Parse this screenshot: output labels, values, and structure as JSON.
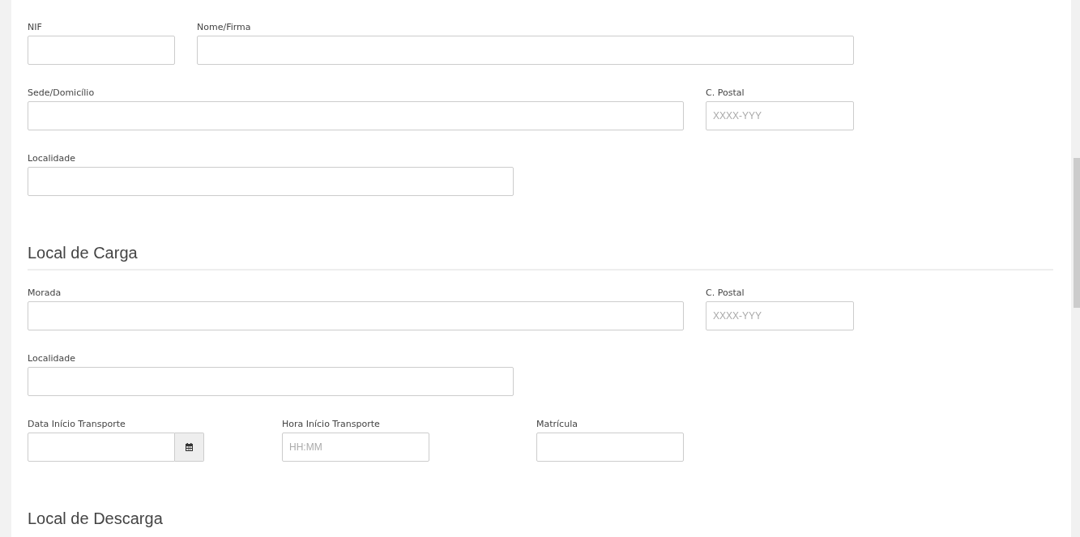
{
  "form": {
    "rows": [
      [
        {
          "label": "NIF",
          "kind": "text"
        },
        {
          "label": "Nome/Firma",
          "kind": "text"
        }
      ],
      [
        {
          "label": "Sede/Domicílio",
          "kind": "text"
        },
        {
          "label": "C. Postal",
          "kind": "text",
          "placeholder": "XXXX-YYY"
        }
      ],
      [
        {
          "label": "Localidade",
          "kind": "text"
        }
      ]
    ]
  },
  "sections": [
    {
      "heading": "Local de Carga",
      "rows": [
        [
          {
            "label": "Morada",
            "kind": "text"
          },
          {
            "label": "C. Postal",
            "kind": "text",
            "placeholder": "XXXX-YYY"
          }
        ],
        [
          {
            "label": "Localidade",
            "kind": "text"
          }
        ],
        [
          {
            "label": "Data Início Transporte",
            "kind": "date"
          },
          {
            "label": "Hora Início Transporte",
            "kind": "text",
            "placeholder": "HH:MM"
          },
          {
            "label": "Matrícula",
            "kind": "text"
          }
        ]
      ]
    },
    {
      "heading": "Local de Descarga"
    }
  ]
}
